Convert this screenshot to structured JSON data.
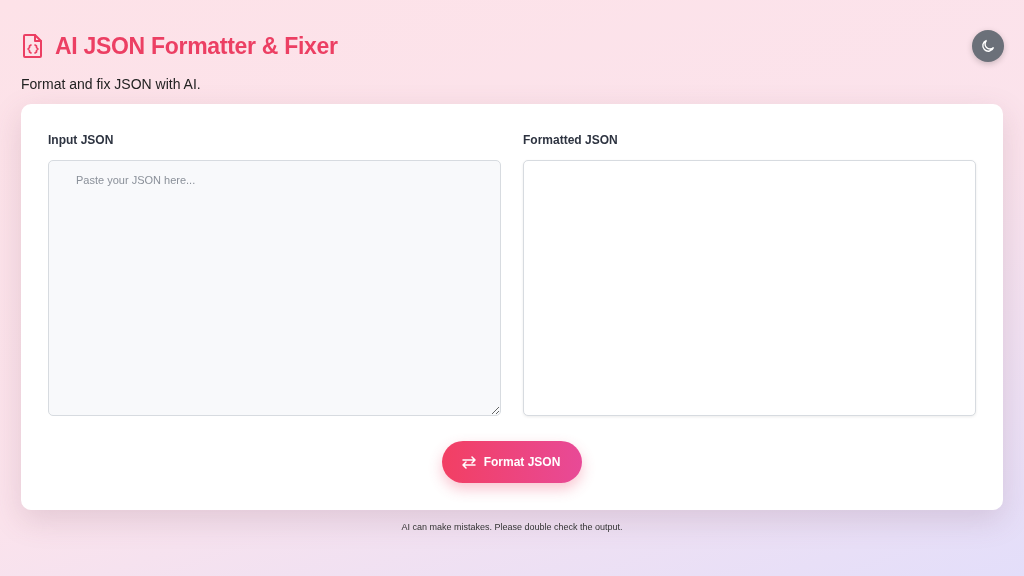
{
  "header": {
    "title": "AI JSON Formatter & Fixer",
    "subtitle": "Format and fix JSON with AI."
  },
  "panels": [
    {
      "kind": "input",
      "label": "Input JSON",
      "placeholder": "Paste your JSON here..."
    },
    {
      "kind": "output",
      "label": "Formatted JSON"
    }
  ],
  "button": {
    "label": "Format JSON"
  },
  "footer": "AI can make mistakes. Please double check the output."
}
